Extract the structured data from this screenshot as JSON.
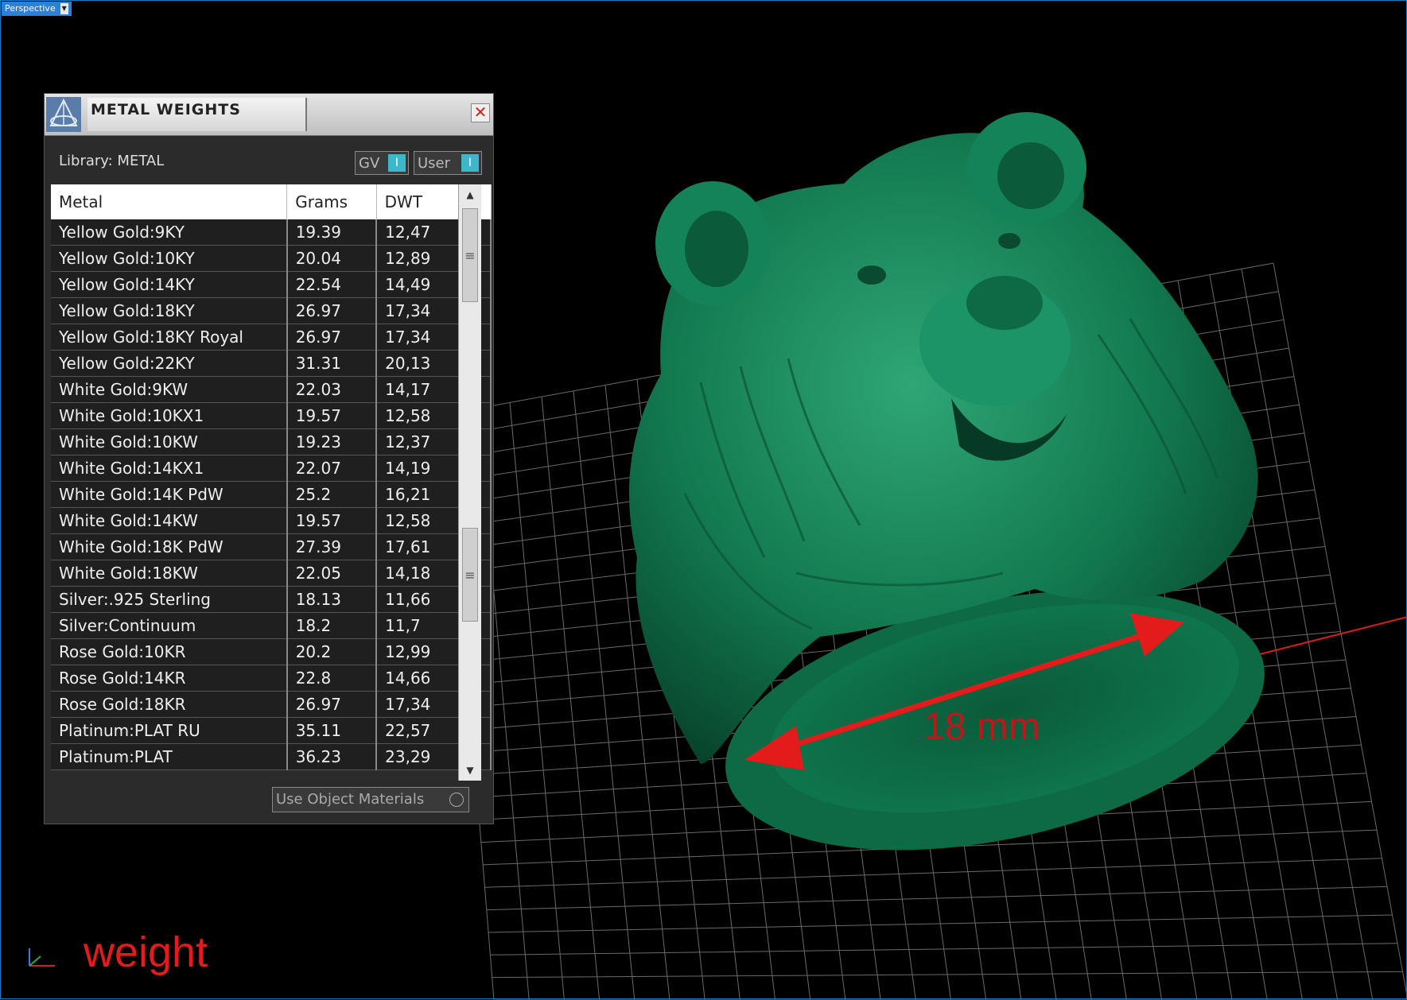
{
  "viewport": {
    "label": "Perspective",
    "dropdown_arrow": "chevron-down-icon"
  },
  "panel": {
    "title": "METAL WEIGHTS",
    "close_icon": "close-icon",
    "library_label": "Library: METAL",
    "toggle_gv": "GV",
    "toggle_user": "User",
    "toggle_knob_glyph": "I",
    "columns": [
      "Metal",
      "Grams",
      "DWT"
    ],
    "rows": [
      {
        "metal": "Yellow Gold:9KY",
        "grams": "19.39",
        "dwt": "12,47"
      },
      {
        "metal": "Yellow Gold:10KY",
        "grams": "20.04",
        "dwt": "12,89"
      },
      {
        "metal": "Yellow Gold:14KY",
        "grams": "22.54",
        "dwt": "14,49"
      },
      {
        "metal": "Yellow Gold:18KY",
        "grams": "26.97",
        "dwt": "17,34"
      },
      {
        "metal": "Yellow Gold:18KY Royal",
        "grams": "26.97",
        "dwt": "17,34"
      },
      {
        "metal": "Yellow Gold:22KY",
        "grams": "31.31",
        "dwt": "20,13"
      },
      {
        "metal": "White Gold:9KW",
        "grams": "22.03",
        "dwt": "14,17"
      },
      {
        "metal": "White Gold:10KX1",
        "grams": "19.57",
        "dwt": "12,58"
      },
      {
        "metal": "White Gold:10KW",
        "grams": "19.23",
        "dwt": "12,37"
      },
      {
        "metal": "White Gold:14KX1",
        "grams": "22.07",
        "dwt": "14,19"
      },
      {
        "metal": "White Gold:14K PdW",
        "grams": "25.2",
        "dwt": "16,21"
      },
      {
        "metal": "White Gold:14KW",
        "grams": "19.57",
        "dwt": "12,58"
      },
      {
        "metal": "White Gold:18K PdW",
        "grams": "27.39",
        "dwt": "17,61"
      },
      {
        "metal": "White Gold:18KW",
        "grams": "22.05",
        "dwt": "14,18"
      },
      {
        "metal": "Silver:.925 Sterling",
        "grams": "18.13",
        "dwt": "11,66"
      },
      {
        "metal": "Silver:Continuum",
        "grams": "18.2",
        "dwt": "11,7"
      },
      {
        "metal": "Rose Gold:10KR",
        "grams": "20.2",
        "dwt": "12,99"
      },
      {
        "metal": "Rose Gold:14KR",
        "grams": "22.8",
        "dwt": "14,66"
      },
      {
        "metal": "Rose Gold:18KR",
        "grams": "26.97",
        "dwt": "17,34"
      },
      {
        "metal": "Platinum:PLAT RU",
        "grams": "35.11",
        "dwt": "22,57"
      },
      {
        "metal": "Platinum:PLAT",
        "grams": "36.23",
        "dwt": "23,29"
      }
    ],
    "use_object_materials": "Use Object Materials"
  },
  "scene": {
    "dimension_label": "18 mm",
    "model_color": "#0f6b45",
    "arrow_color": "#e31b1b"
  },
  "annotation": {
    "weight_label": "weight"
  }
}
